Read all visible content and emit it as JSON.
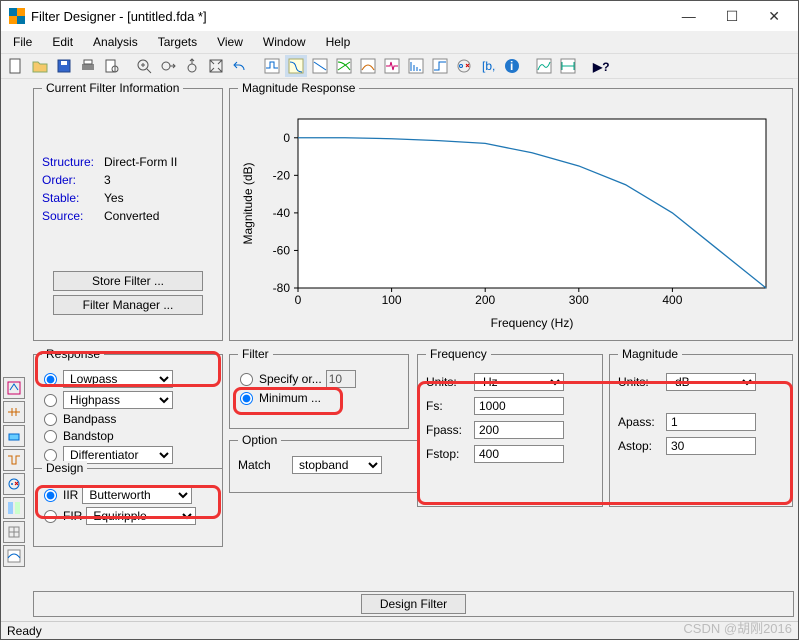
{
  "window": {
    "title": "Filter Designer -  [untitled.fda *]"
  },
  "menu": [
    "File",
    "Edit",
    "Analysis",
    "Targets",
    "View",
    "Window",
    "Help"
  ],
  "statusbar": "Ready",
  "watermark": "CSDN @胡刚2016",
  "info_panel": {
    "legend": "Current Filter Information",
    "rows": [
      {
        "label": "Structure:",
        "value": "Direct-Form II"
      },
      {
        "label": "Order:",
        "value": "3"
      },
      {
        "label": "Stable:",
        "value": "Yes"
      },
      {
        "label": "Source:",
        "value": "Converted"
      }
    ],
    "store_btn": "Store Filter ...",
    "manager_btn": "Filter Manager ..."
  },
  "mag_panel": {
    "legend": "Magnitude Response"
  },
  "chart_data": {
    "type": "line",
    "xlabel": "Frequency (Hz)",
    "ylabel": "Magnitude (dB)",
    "xlim": [
      0,
      500
    ],
    "ylim": [
      -80,
      10
    ],
    "xticks": [
      0,
      100,
      200,
      300,
      400
    ],
    "yticks": [
      0,
      -20,
      -40,
      -60,
      -80
    ],
    "x": [
      0,
      50,
      100,
      150,
      200,
      250,
      300,
      350,
      400,
      450,
      500
    ],
    "y": [
      0,
      0,
      -0.5,
      -1.5,
      -3,
      -8,
      -15,
      -25,
      -40,
      -60,
      -80
    ]
  },
  "response": {
    "legend": "Response",
    "lowpass": "Lowpass",
    "highpass": "Highpass",
    "bandpass": "Bandpass",
    "bandstop": "Bandstop",
    "diff": "Differentiator",
    "design_legend": "Design",
    "iir": "IIR",
    "iir_sel": "Butterworth",
    "fir": "FIR",
    "fir_sel": "Equiripple"
  },
  "filter": {
    "legend": "Filter",
    "specify": "Specify or...",
    "specify_val": "10",
    "minimum": "Minimum ..."
  },
  "option": {
    "legend": "Option",
    "match": "Match",
    "match_val": "stopband"
  },
  "freq": {
    "legend": "Frequency",
    "units_lbl": "Units:",
    "units": "Hz",
    "fs_lbl": "Fs:",
    "fs": "1000",
    "fpass_lbl": "Fpass:",
    "fpass": "200",
    "fstop_lbl": "Fstop:",
    "fstop": "400"
  },
  "magn": {
    "legend": "Magnitude",
    "units_lbl": "Units:",
    "units": "dB",
    "apass_lbl": "Apass:",
    "apass": "1",
    "astop_lbl": "Astop:",
    "astop": "30"
  },
  "design_btn": "Design Filter"
}
